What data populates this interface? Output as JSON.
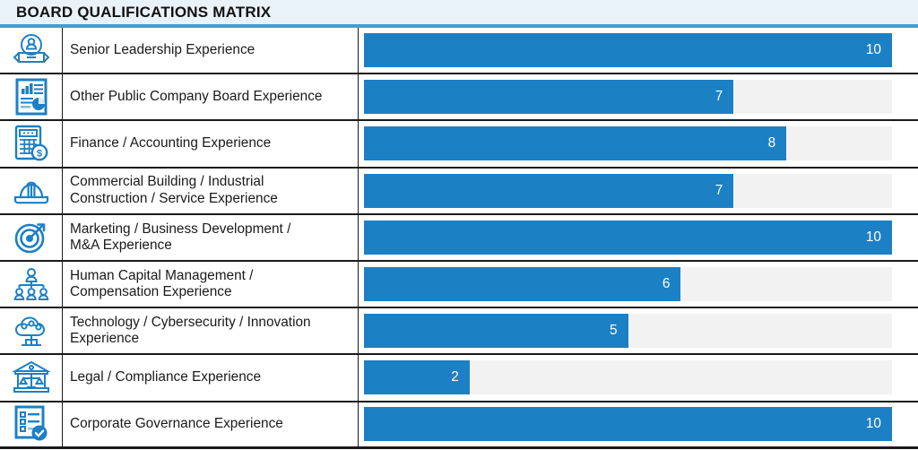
{
  "header": {
    "title": "BOARD QUALIFICATIONS MATRIX",
    "bg_color": "#e9f2f8",
    "accent_color": "#3f9fd4"
  },
  "theme": {
    "bar_fill_color": "#1c80c4",
    "bar_track_color": "#f2f2f2",
    "icon_color": "#1c80c4",
    "text_color": "#1a1a1a",
    "value_text_color": "#ffffff"
  },
  "chart_data": {
    "type": "bar",
    "title": "BOARD QUALIFICATIONS MATRIX",
    "orientation": "horizontal",
    "xlabel": "",
    "ylabel": "",
    "xlim": [
      0,
      10
    ],
    "grid": false,
    "legend": "none",
    "categories": [
      "Senior Leadership Experience",
      "Other Public Company Board Experience",
      "Finance / Accounting Experience",
      "Commercial Building / Industrial Construction / Service Experience",
      "Marketing / Business Development / M&A Experience",
      "Human Capital Management / Compensation Experience",
      "Technology / Cybersecurity / Innovation Experience",
      "Legal / Compliance Experience",
      "Corporate Governance Experience"
    ],
    "values": [
      10,
      7,
      8,
      7,
      10,
      6,
      5,
      2,
      10
    ]
  },
  "rows": [
    {
      "icon": "award-badge-icon",
      "label": "Senior Leadership Experience",
      "label_lines": [
        "Senior Leadership Experience"
      ],
      "value": 10,
      "value_text": "10",
      "pct": 100
    },
    {
      "icon": "report-document-icon",
      "label": "Other Public Company Board Experience",
      "label_lines": [
        "Other Public Company Board Experience"
      ],
      "value": 7,
      "value_text": "7",
      "pct": 70
    },
    {
      "icon": "calculator-dollar-icon",
      "label": "Finance / Accounting Experience",
      "label_lines": [
        "Finance / Accounting Experience"
      ],
      "value": 8,
      "value_text": "8",
      "pct": 80
    },
    {
      "icon": "hard-hat-icon",
      "label": "Commercial Building / Industrial Construction / Service Experience",
      "label_lines": [
        "Commercial Building / Industrial",
        "Construction / Service Experience"
      ],
      "value": 7,
      "value_text": "7",
      "pct": 70
    },
    {
      "icon": "target-arrow-icon",
      "label": "Marketing / Business Development / M&A Experience",
      "label_lines": [
        "Marketing / Business Development /",
        "M&A Experience"
      ],
      "value": 10,
      "value_text": "10",
      "pct": 100
    },
    {
      "icon": "org-chart-people-icon",
      "label": "Human Capital Management / Compensation Experience",
      "label_lines": [
        "Human Capital Management /",
        "Compensation Experience"
      ],
      "value": 6,
      "value_text": "6",
      "pct": 60
    },
    {
      "icon": "cloud-network-icon",
      "label": "Technology / Cybersecurity / Innovation Experience",
      "label_lines": [
        "Technology / Cybersecurity / Innovation",
        "Experience"
      ],
      "value": 5,
      "value_text": "5",
      "pct": 50
    },
    {
      "icon": "courthouse-scales-icon",
      "label": "Legal / Compliance Experience",
      "label_lines": [
        "Legal / Compliance Experience"
      ],
      "value": 2,
      "value_text": "2",
      "pct": 20
    },
    {
      "icon": "checklist-approved-icon",
      "label": "Corporate Governance Experience",
      "label_lines": [
        "Corporate Governance Experience"
      ],
      "value": 10,
      "value_text": "10",
      "pct": 100
    }
  ]
}
